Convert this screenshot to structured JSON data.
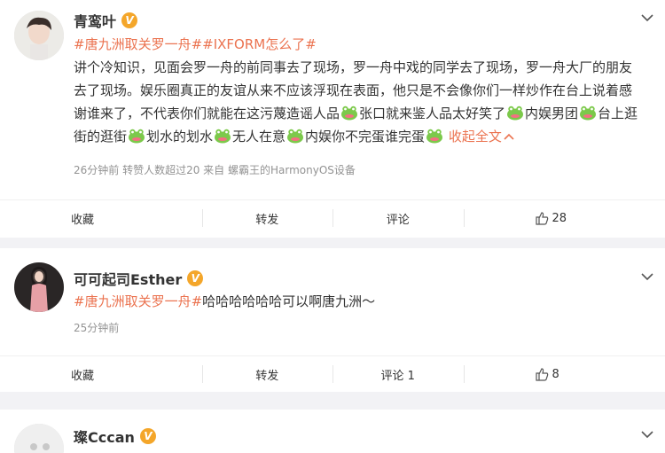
{
  "posts": [
    {
      "username": "青鸾叶",
      "verified": true,
      "topics": "#唐九洲取关罗一舟##IXFORM怎么了#",
      "body_parts": [
        "讲个冷知识，见面会罗一舟的前同事去了现场，罗一舟中戏的同学去了现场，罗一舟大厂的朋友去了现场。娱乐圈真正的友谊从来不应该浮现在表面，他只是不会像你们一样炒作在台上说着感谢谁来了，不代表你们就能在这污蔑造谣人品",
        "张口就来鉴人品太好笑了",
        "内娱男团",
        "台上逛街的逛街",
        "划水的划水",
        "无人在意",
        "内娱你不完蛋谁完蛋"
      ],
      "collapse_label": "收起全文",
      "meta": "26分钟前 转赞人数超过20   来自 螺霸王的HarmonyOS设备",
      "actions": {
        "share": "收藏",
        "repost": "转发",
        "comment": "评论",
        "likes": "28"
      }
    },
    {
      "username": "可可起司Esther",
      "verified": true,
      "topic": "#唐九洲取关罗一舟#",
      "text": "哈哈哈哈哈哈可以啊唐九洲～",
      "meta": "25分钟前",
      "actions": {
        "share": "收藏",
        "repost": "转发",
        "comment": "评论 1",
        "likes": "8"
      }
    },
    {
      "username": "璨Cccan",
      "verified": true
    }
  ],
  "colors": {
    "topic": "#eb7350",
    "badge": "#f4a62a",
    "background": "#f2f2f5"
  },
  "icons": [
    "verified-badge-icon",
    "chevron-down-icon",
    "frog-emoji-icon",
    "chevron-up-icon",
    "thumbs-up-icon"
  ]
}
